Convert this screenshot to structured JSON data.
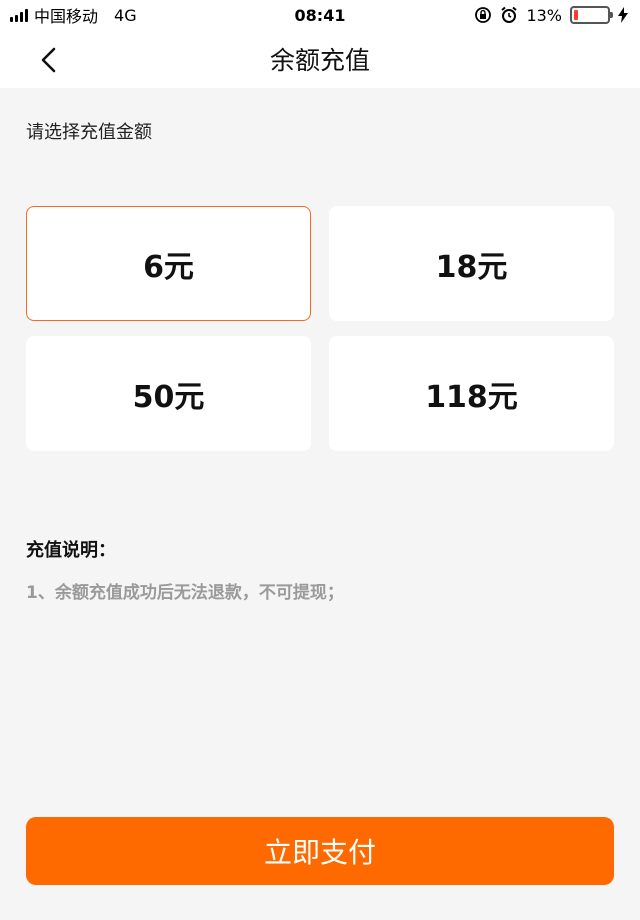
{
  "status_bar": {
    "carrier": "中国移动",
    "network": "4G",
    "time": "08:41",
    "battery_percent": "13%",
    "battery_level": 0.13,
    "icons": [
      "signal-icon",
      "orientation-lock-icon",
      "alarm-icon",
      "battery-icon",
      "charging-icon"
    ]
  },
  "nav": {
    "title": "余额充值",
    "back_icon": "chevron-left-icon"
  },
  "prompt": "请选择充值金额",
  "amounts": [
    {
      "label": "6元",
      "selected": true
    },
    {
      "label": "18元",
      "selected": false
    },
    {
      "label": "50元",
      "selected": false
    },
    {
      "label": "118元",
      "selected": false
    }
  ],
  "notes": {
    "title": "充值说明：",
    "items": [
      "1、余额充值成功后无法退款，不可提现；"
    ]
  },
  "pay_button_label": "立即支付",
  "colors": {
    "accent": "#ff6a00",
    "selected_border": "#f36b1c",
    "background": "#f5f5f5"
  }
}
